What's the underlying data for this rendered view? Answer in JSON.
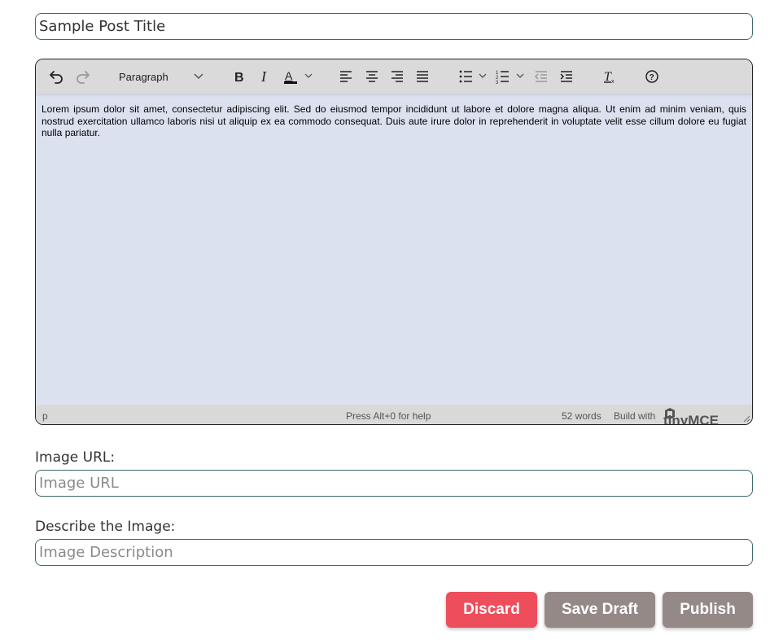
{
  "form": {
    "title_value": "Sample Post Title",
    "image_url_label": "Image URL:",
    "image_url_placeholder": "Image URL",
    "image_desc_label": "Describe the Image:",
    "image_desc_placeholder": "Image Description"
  },
  "editor": {
    "toolbar": {
      "block_format": "Paragraph",
      "buttons": [
        "undo-icon",
        "redo-icon",
        "bold-icon",
        "italic-icon",
        "text-color-icon",
        "align-left-icon",
        "align-center-icon",
        "align-right-icon",
        "justify-icon",
        "bullet-list-icon",
        "numbered-list-icon",
        "outdent-icon",
        "indent-icon",
        "clear-formatting-icon",
        "help-icon"
      ]
    },
    "content": "Lorem ipsum dolor sit amet, consectetur adipiscing elit. Sed do eiusmod tempor incididunt ut labore et dolore magna aliqua. Ut enim ad minim veniam, quis nostrud exercitation ullamco laboris nisi ut aliquip ex ea commodo consequat. Duis aute irure dolor in reprehenderit in voluptate velit esse cillum dolore eu fugiat nulla pariatur.",
    "status": {
      "path": "p",
      "help": "Press Alt+0 for help",
      "words": "52 words",
      "build": "Build with",
      "brand": "tinyMCE"
    }
  },
  "actions": {
    "discard": "Discard",
    "save_draft": "Save Draft",
    "publish": "Publish"
  },
  "colors": {
    "discard": "#ee4d5b",
    "secondary": "#958987",
    "editor_bg": "#dce1ef",
    "input_border": "#3d6b6b"
  }
}
